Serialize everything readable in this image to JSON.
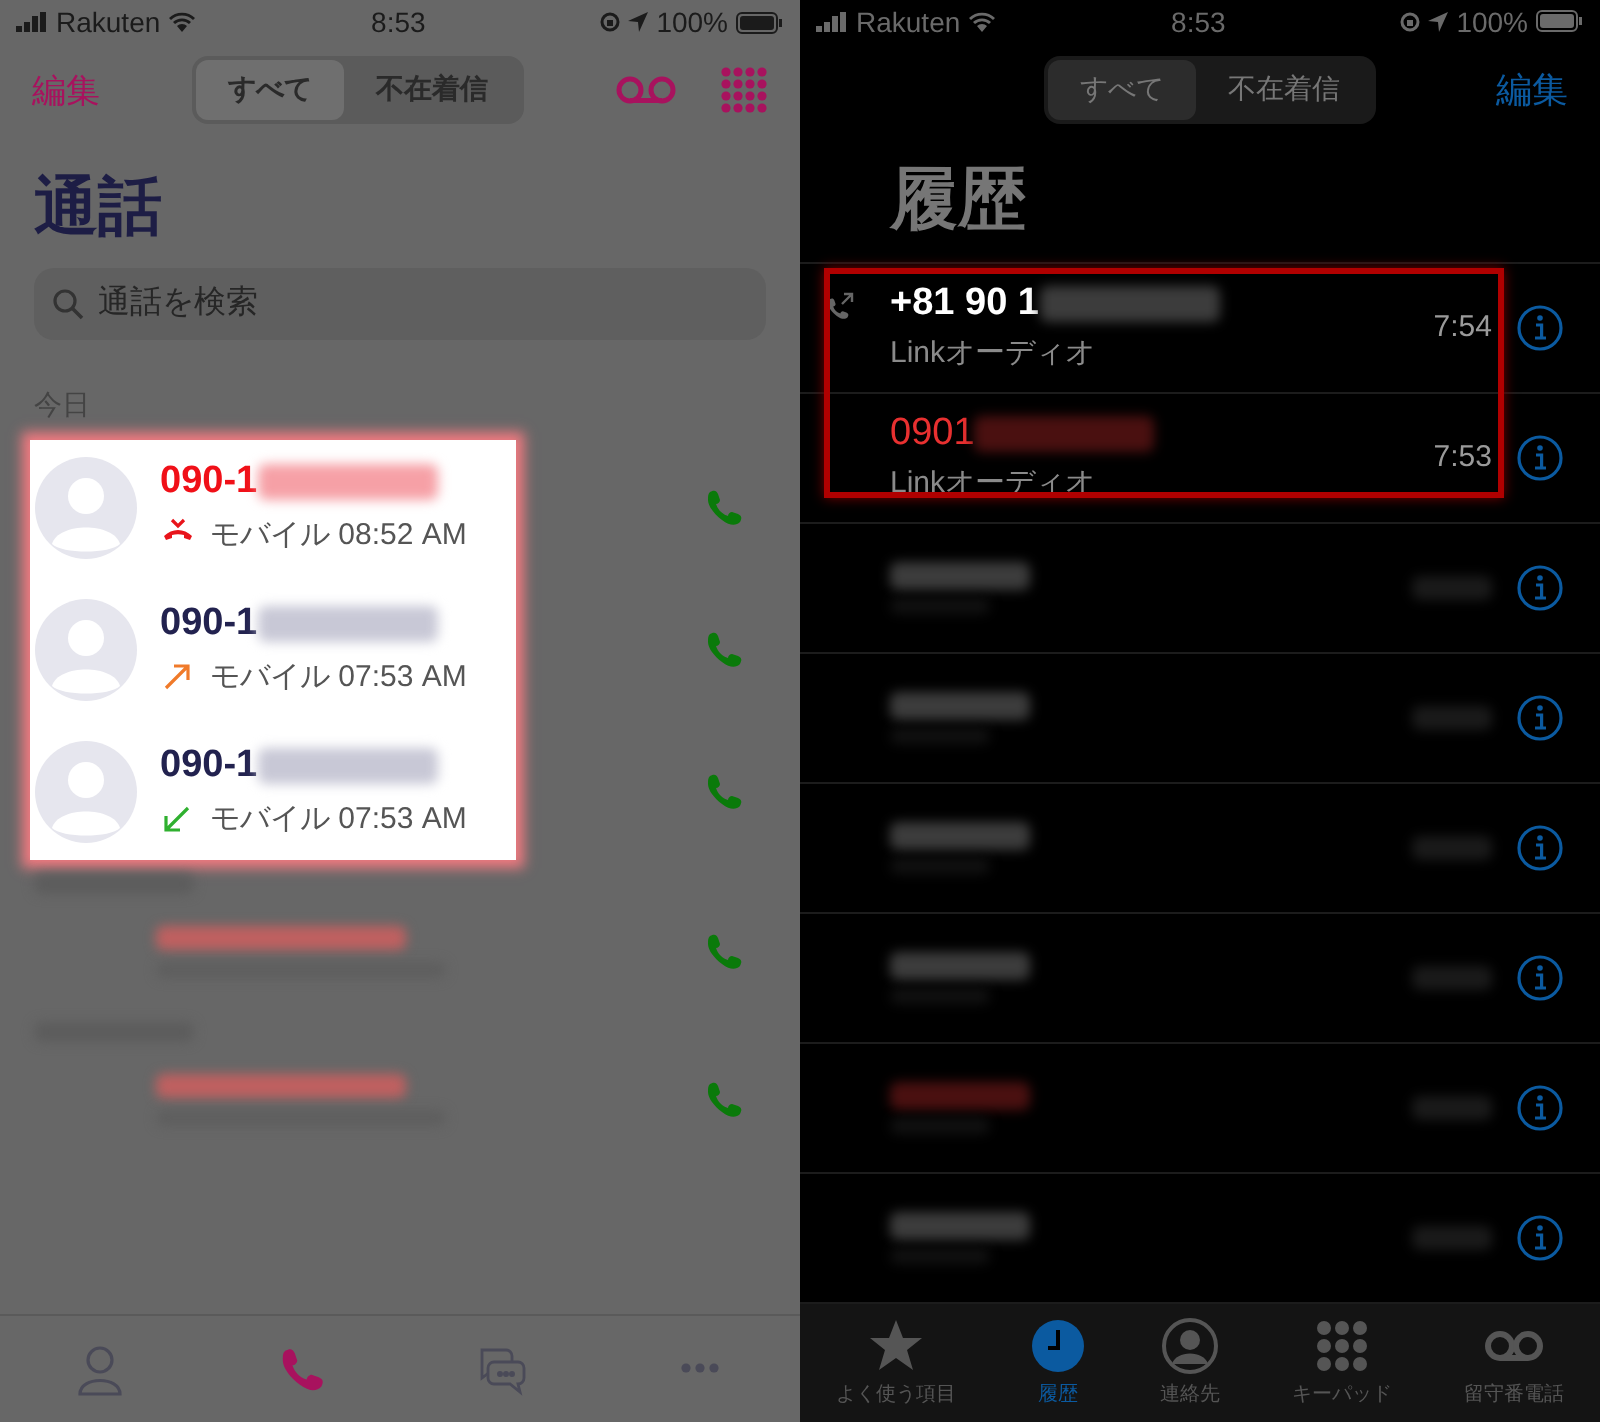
{
  "left_screen": {
    "status_bar": {
      "carrier": "Rakuten",
      "time": "8:53",
      "battery": "100%"
    },
    "edit": "編集",
    "segments": [
      {
        "label": "すべて",
        "selected": true
      },
      {
        "label": "不在着信",
        "selected": false
      }
    ],
    "title": "通話",
    "search": {
      "placeholder": "通話を検索"
    },
    "section": "今日",
    "calls": [
      {
        "number": "090-1",
        "kind": "missed",
        "detail": "モバイル 08:52 AM"
      },
      {
        "number": "090-1",
        "kind": "outgoing",
        "detail": "モバイル 07:53 AM"
      },
      {
        "number": "090-1",
        "kind": "incoming",
        "detail": "モバイル 07:53 AM"
      }
    ],
    "blurred_rows": [
      {
        "missed": true
      },
      {
        "missed": true
      }
    ],
    "tabs": [
      {
        "kind": "contacts",
        "selected": false
      },
      {
        "kind": "calls",
        "selected": true
      },
      {
        "kind": "chat",
        "selected": false
      },
      {
        "kind": "more",
        "selected": false
      }
    ]
  },
  "right_screen": {
    "status_bar": {
      "carrier": "Rakuten",
      "time": "8:53",
      "battery": "100%"
    },
    "segments": [
      {
        "label": "すべて",
        "selected": true
      },
      {
        "label": "不在着信",
        "selected": false
      }
    ],
    "edit": "編集",
    "title": "履歴",
    "calls": [
      {
        "number": "+81 90 1",
        "kind": "outgoing",
        "detail": "Linkオーディオ",
        "time": "7:54"
      },
      {
        "number": "0901",
        "kind": "missed",
        "detail": "Linkオーディオ",
        "time": "7:53"
      }
    ],
    "blurred_rows": [
      {
        "missed": false
      },
      {
        "missed": false
      },
      {
        "missed": false
      },
      {
        "missed": false
      },
      {
        "missed": true
      },
      {
        "missed": false
      }
    ],
    "tabs": [
      {
        "kind": "favorites",
        "label": "よく使う項目",
        "selected": false
      },
      {
        "kind": "recents",
        "label": "履歴",
        "selected": true
      },
      {
        "kind": "contacts",
        "label": "連絡先",
        "selected": false
      },
      {
        "kind": "keypad",
        "label": "キーパッド",
        "selected": false
      },
      {
        "kind": "voicemail",
        "label": "留守番電話",
        "selected": false
      }
    ]
  }
}
